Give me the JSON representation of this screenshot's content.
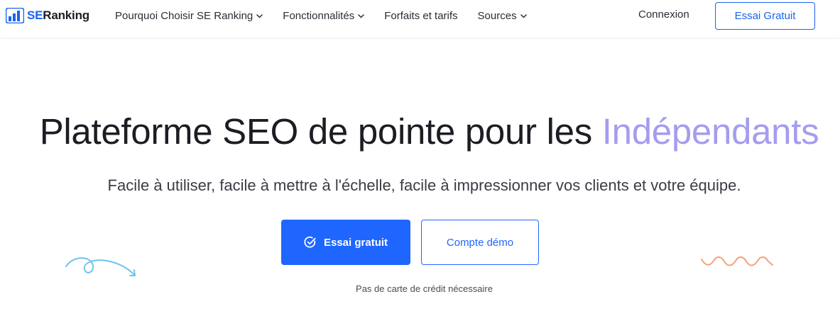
{
  "brand": {
    "prefix": "SE",
    "name": "Ranking"
  },
  "nav": {
    "items": [
      {
        "label": "Pourquoi Choisir SE Ranking",
        "dropdown": true
      },
      {
        "label": "Fonctionnalités",
        "dropdown": true
      },
      {
        "label": "Forfaits et tarifs",
        "dropdown": false
      },
      {
        "label": "Sources",
        "dropdown": true
      }
    ],
    "login_label": "Connexion",
    "cta_label": "Essai Gratuit"
  },
  "hero": {
    "title_main": "Plateforme SEO de pointe pour les ",
    "title_accent": "Indépendants",
    "subtitle": "Facile à utiliser, facile à mettre à l'échelle, facile à impressionner vos clients et votre équipe.",
    "primary_label": "Essai gratuit",
    "secondary_label": "Compte démo",
    "note": "Pas de carte de crédit nécessaire"
  },
  "colors": {
    "brand_blue": "#1a64f0",
    "button_blue": "#1f66ff",
    "accent_purple": "#a39df0",
    "deco_blue": "#6ec3ee",
    "deco_orange": "#f7a072"
  },
  "icons": [
    "logo-bars-icon",
    "chevron-down-icon",
    "check-circle-icon",
    "loop-arrow-decoration",
    "wave-decoration"
  ]
}
